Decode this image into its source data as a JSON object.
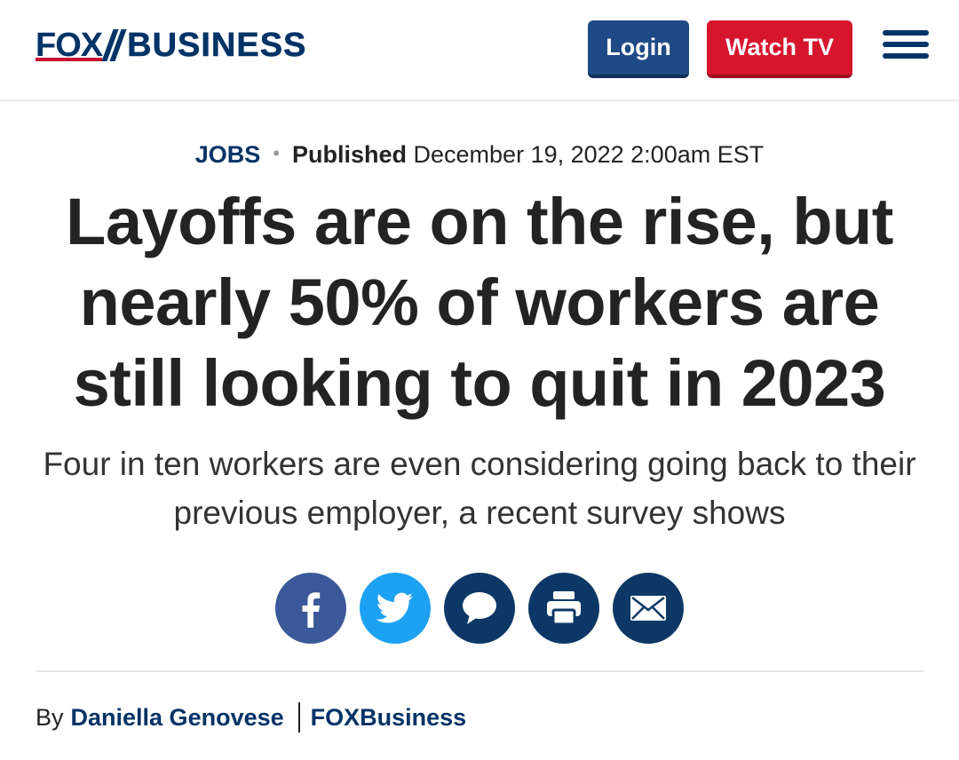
{
  "header": {
    "logo_fox": "FOX",
    "logo_business": "BUSINESS",
    "login_label": "Login",
    "watch_tv_label": "Watch TV",
    "menu_icon": "hamburger-menu-icon"
  },
  "meta": {
    "category": "JOBS",
    "separator": "•",
    "published_label": "Published",
    "published_date": "December 19, 2022 2:00am EST"
  },
  "article": {
    "headline": "Layoffs are on the rise, but nearly 50% of workers are still looking to quit in 2023",
    "subheadline": "Four in ten workers are even considering going back to their previous employer, a recent survey shows"
  },
  "share": {
    "icons": [
      "facebook-icon",
      "twitter-icon",
      "comment-icon",
      "print-icon",
      "email-icon"
    ],
    "colors": {
      "facebook": "#3b5998",
      "twitter": "#1da1f2",
      "navy": "#0d3866"
    }
  },
  "byline": {
    "by_label": "By",
    "author": "Daniella Genovese",
    "source": "FOXBusiness"
  },
  "colors": {
    "brand_navy": "#003366",
    "login_blue": "#1e4a85",
    "watch_red": "#d7152d"
  }
}
